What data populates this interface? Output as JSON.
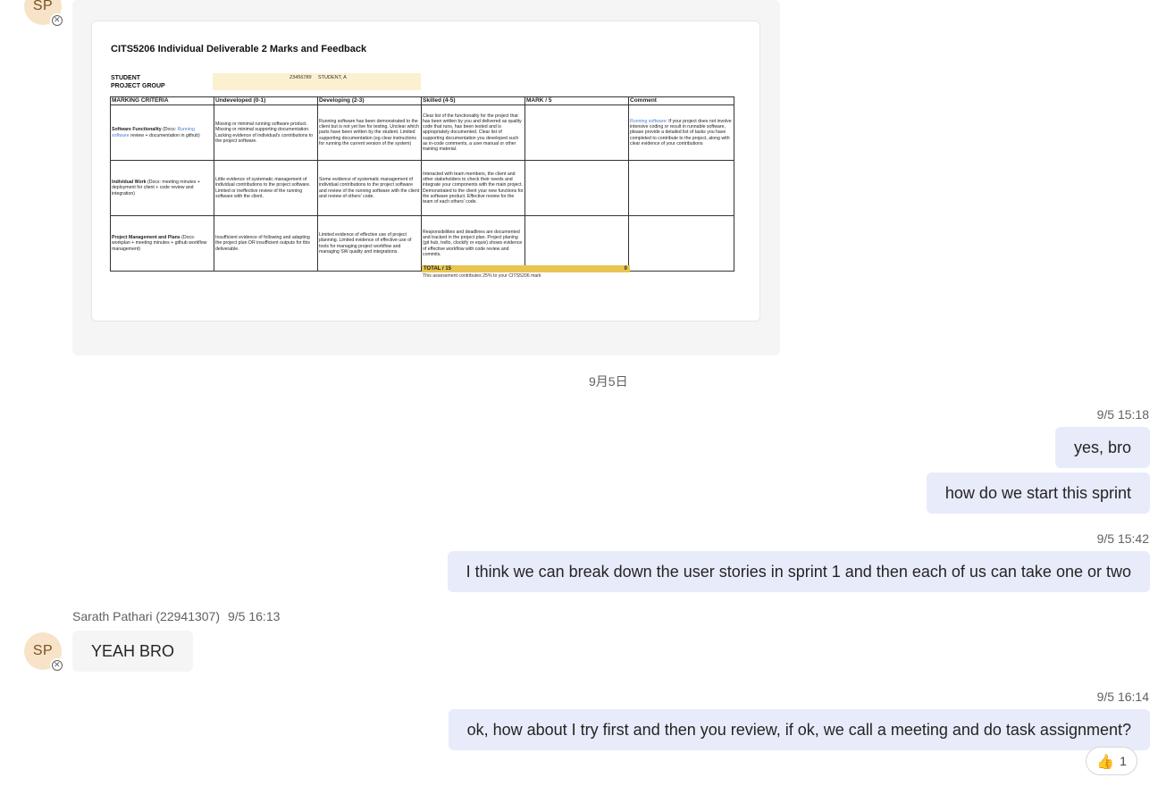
{
  "avatar_initials": "SP",
  "attachment": {
    "title": "CITS5206 Individual Deliverable 2 Marks and Feedback",
    "student_label": "STUDENT",
    "project_group_label": "PROJECT GROUP",
    "student_id": "23456789",
    "student_name": "STUDENT, A",
    "headers": [
      "MARKING CRITERIA",
      "Undeveloped (0-1)",
      "Developing (2-3)",
      "Skilled (4-5)",
      "MARK / 5",
      "Comment"
    ],
    "rows": [
      {
        "criteria_bold": "Software Functionality",
        "criteria_rest": " (Docs: ",
        "criteria_link": "Running software",
        "criteria_tail": " review + documentation in github)",
        "undeveloped": "Missing or minimal running software product. Missing or minimal supporting documentation. Lacking evidence of individual's contributions to the project software.",
        "developing": "Running software has been demonstrated to the client but is not yet live for testing. Unclear which parts have been written by the student. Limited supporting documentation (eg clear instructions for running the current version of the system)",
        "skilled": "Clear list of the functionality for the project that has been written by you and delivered as quality code that runs, has been tested and is appropriately documented. Clear list of supporting documentation you developed such as in-code comments, a user manual or other training material.",
        "mark": "",
        "comment_link": "Running software",
        "comment": ": If your project does not involve intensive coding or result in runnable software, please provide a detailed list of tasks you have completed to contribute to the project, along with clear evidence of your contributions"
      },
      {
        "criteria_bold": "Individual Work",
        "criteria_rest": " (Docs: meeting minutes + deployment for client + code review and integration)",
        "criteria_link": "",
        "criteria_tail": "",
        "undeveloped": "Little evidence of systematic management of individual contributions to the project software. Limited or ineffective review of the running software with the client.",
        "developing": "Some evidence of systematic management of individual contributions to the project software and review of the running software with the client and review of others' code.",
        "skilled": "Interacted with team members, the client and other stakeholders to check their needs and integrate your components with the main project. Demonstrated to the client your new functions for the software product. Effective review for the team of each others' code.",
        "mark": "",
        "comment_link": "",
        "comment": ""
      },
      {
        "criteria_bold": "Project Management and Plans",
        "criteria_rest": " (Docs: workplan + meeting minutes + github workflow management)",
        "criteria_link": "",
        "criteria_tail": "",
        "undeveloped": "Insufficient evidence of following and adapting the project plan OR insufficient outputs for this deliverable.",
        "developing": "Limited evidence of effective use of project planning. Limited evidence of effective use of tools for managing project workflow and managing SW quality and integrations.",
        "skilled": "Responsibilities and deadlines are documented and tracked in the project plan. Project planing (git hub, trello, clockify or equiv) shows evidence of effective workflow with code review and commits.",
        "mark": "",
        "comment_link": "",
        "comment": ""
      }
    ],
    "total_label": "TOTAL / 15",
    "total_value": "0",
    "note": "This assessment contributes 25% to your CITS5206 mark"
  },
  "date_divider": "9月5日",
  "messages": [
    {
      "timestamp": "9/5 15:18",
      "text": "yes, bro"
    },
    {
      "text": "how do we start this sprint"
    },
    {
      "timestamp": "9/5 15:42",
      "text": "I think we can break down the user stories in sprint 1 and then each of us can take one or two"
    },
    {
      "sender": "Sarath Pathari (22941307)",
      "time": "9/5 16:13",
      "text": "YEAH BRO"
    },
    {
      "timestamp": "9/5 16:14",
      "text": "ok, how about I try first and then you review, if ok, we call a meeting and do task assignment?"
    }
  ],
  "reaction": {
    "icon": "thumbs-up",
    "count": "1"
  },
  "colors": {
    "outgoing_bubble": "#e8ebfa",
    "incoming_bubble": "#f5f5f5",
    "avatar_bg": "#f7e3c8",
    "avatar_text": "#7a5122"
  }
}
